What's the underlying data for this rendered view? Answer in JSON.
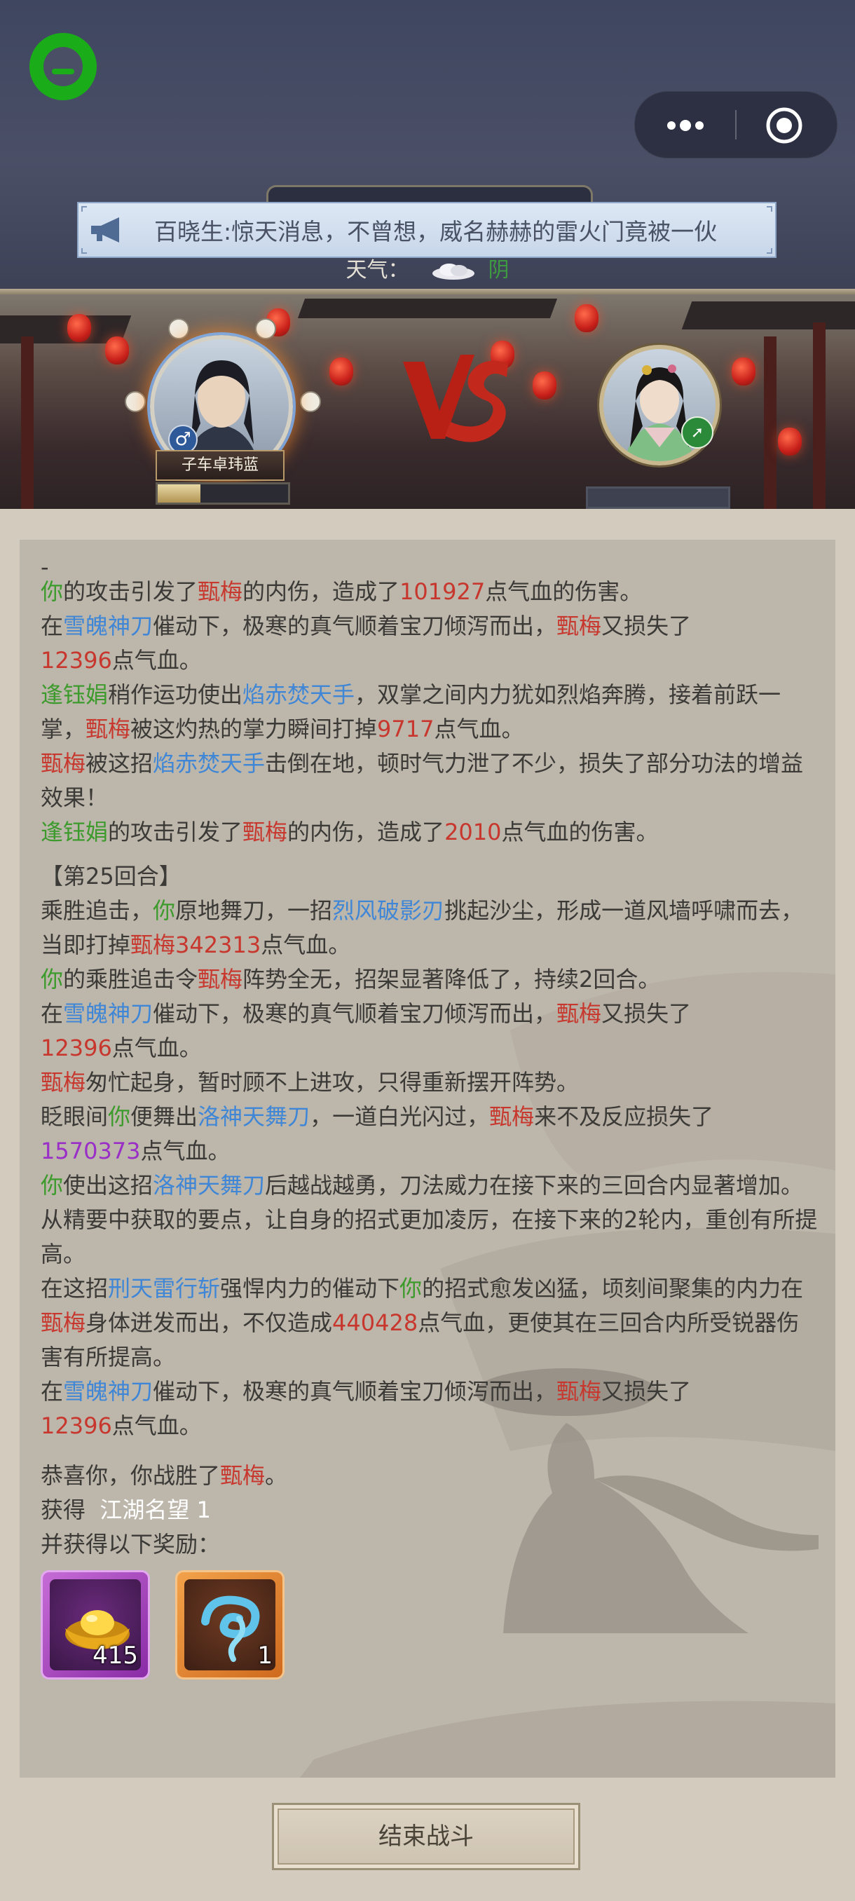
{
  "header": {
    "menu_icon": "more-dots-icon",
    "close_icon": "circle-target-icon",
    "announcement_icon": "megaphone-icon",
    "announcement": "百晓生:惊天消息，不曾想，威名赫赫的雷火门竟被一伙",
    "weather_label": "天气：",
    "weather_icon": "cloud-icon",
    "weather_value": "阴"
  },
  "battle": {
    "player_name": "子车卓玮蓝",
    "player_progress": 0.33,
    "enemy_progress": 0.0,
    "vs_icon": "vs-icon",
    "gender_icon": "male-icon",
    "enemy_badge_icon": "sword-icon"
  },
  "log": {
    "top_marker": "-",
    "l1": {
      "a": "你",
      "b": "的攻击引发了",
      "c": "甄梅",
      "d": "的内伤，造成了",
      "e": "101927",
      "f": "点气血的伤害。"
    },
    "l2": {
      "a": "在",
      "b": "雪魄神刀",
      "c": "催动下，极寒的真气顺着宝刀倾泻而出，",
      "d": "甄梅",
      "e": "又损失了",
      "f": "12396",
      "g": "点气血。"
    },
    "l3": {
      "a": "逢钰娟",
      "b": "稍作运功使出",
      "c": "焰赤焚天手",
      "d": "，双掌之间内力犹如烈焰奔腾，接着前跃一掌，",
      "e": "甄梅",
      "f": "被这灼热的掌力瞬间打掉",
      "g": "9717",
      "h": "点气血。"
    },
    "l4": {
      "a": "甄梅",
      "b": "被这招",
      "c": "焰赤焚天手",
      "d": "击倒在地，顿时气力泄了不少，损失了部分功法的增益效果！"
    },
    "l5": {
      "a": "逢钰娟",
      "b": "的攻击引发了",
      "c": "甄梅",
      "d": "的内伤，造成了",
      "e": "2010",
      "f": "点气血的伤害。"
    },
    "round": "【第25回合】",
    "l6": {
      "a": "乘胜追击，",
      "b": "你",
      "c": "原地舞刀，一招",
      "d": "烈风破影刃",
      "e": "挑起沙尘，形成一道风墙呼啸而去，当即打掉",
      "f": "甄梅",
      "g": "342313",
      "h": "点气血。"
    },
    "l7": {
      "a": "你",
      "b": "的乘胜追击令",
      "c": "甄梅",
      "d": "阵势全无，招架显著降低了，持续2回合。"
    },
    "l8": {
      "a": "在",
      "b": "雪魄神刀",
      "c": "催动下，极寒的真气顺着宝刀倾泻而出，",
      "d": "甄梅",
      "e": "又损失了",
      "f": "12396",
      "g": "点气血。"
    },
    "l9": {
      "a": "甄梅",
      "b": "匆忙起身，暂时顾不上进攻，只得重新摆开阵势。"
    },
    "l10": {
      "a": "眨眼间",
      "b": "你",
      "c": "便舞出",
      "d": "洛神天舞刀",
      "e": "，一道白光闪过，",
      "f": "甄梅",
      "g": "来不及反应损失了",
      "h": "1570373",
      "i": "点气血。"
    },
    "l11": {
      "a": "你",
      "b": "使出这招",
      "c": "洛神天舞刀",
      "d": "后越战越勇，刀法威力在接下来的三回合内显著增加。"
    },
    "l12": "从精要中获取的要点，让自身的招式更加凌厉，在接下来的2轮内，重创有所提高。",
    "l13": {
      "a": "在这招",
      "b": "刑天雷行斩",
      "c": "强悍内力的催动下",
      "d": "你",
      "e": "的招式愈发凶猛，顷刻间聚集的内力在",
      "f": "甄梅",
      "g": "身体迸发而出，不仅造成",
      "h": "440428",
      "i": "点气血，更使其在三回合内所受锐器伤害有所提高。"
    },
    "l14": {
      "a": "在",
      "b": "雪魄神刀",
      "c": "催动下，极寒的真气顺着宝刀倾泻而出，",
      "d": "甄梅",
      "e": "又损失了",
      "f": "12396",
      "g": "点气血。"
    },
    "victory": {
      "a": "恭喜你，你战胜了",
      "b": "甄梅",
      "c": "。"
    },
    "reputation": {
      "label": "获得",
      "value": "江湖名望 1"
    },
    "rewards_label": "并获得以下奖励：",
    "rewards": [
      {
        "icon": "gold-ingot-icon",
        "count": "415"
      },
      {
        "icon": "blue-gourd-icon",
        "count": "1"
      }
    ]
  },
  "footer": {
    "end_button": "结束战斗"
  },
  "colors": {
    "self_green": "#3c9b2c",
    "enemy_red": "#c8372d",
    "skill_blue": "#3f87d6",
    "crit_purple": "#9a2fc8"
  }
}
